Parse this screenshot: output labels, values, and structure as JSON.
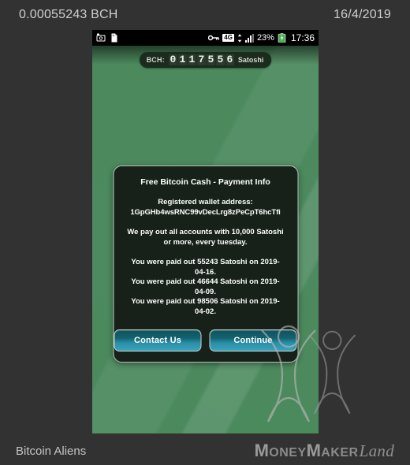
{
  "top_bar": {
    "amount": "0.00055243 BCH",
    "date": "16/4/2019"
  },
  "bottom_bar": {
    "app_name": "Bitcoin Aliens",
    "logo": {
      "money_cap": "M",
      "money_rest": "ONEY",
      "maker_cap": "M",
      "maker_rest": "AKER",
      "land": "Land"
    }
  },
  "phone": {
    "statusbar": {
      "left_icons": [
        "screenshot-icon",
        "document-icon"
      ],
      "vpn_key_icon": "key-icon",
      "network": "4G",
      "battery_percent": "23%",
      "battery_icon": "battery-charging-icon",
      "clock": "17:36"
    },
    "counter": {
      "label": "BCH:",
      "digits": [
        "0",
        "1",
        "1",
        "7",
        "5",
        "5",
        "6"
      ],
      "unit": "Satoshi"
    },
    "dialog": {
      "title": "Free Bitcoin Cash - Payment Info",
      "wallet_label": "Registered wallet address:",
      "wallet_address": "1GpGHb4wsRNC99vDecLrg8zPeCpT6hcTfi",
      "note": "We pay out all accounts with 10,000 Satoshi or more, every tuesday.",
      "payouts": [
        "You were paid out 55243 Satoshi on 2019-04-16.",
        "You were paid out 46644 Satoshi on 2019-04-09.",
        "You were paid out 98506 Satoshi on 2019-04-02."
      ],
      "buttons": {
        "contact": "Contact Us",
        "continue": "Continue"
      }
    }
  },
  "colors": {
    "page_background": "#323232",
    "app_green": "#4c8a5e",
    "dialog_background": "#17211a",
    "button_accent": "#2a8fa8",
    "battery_green": "#4caf50"
  }
}
